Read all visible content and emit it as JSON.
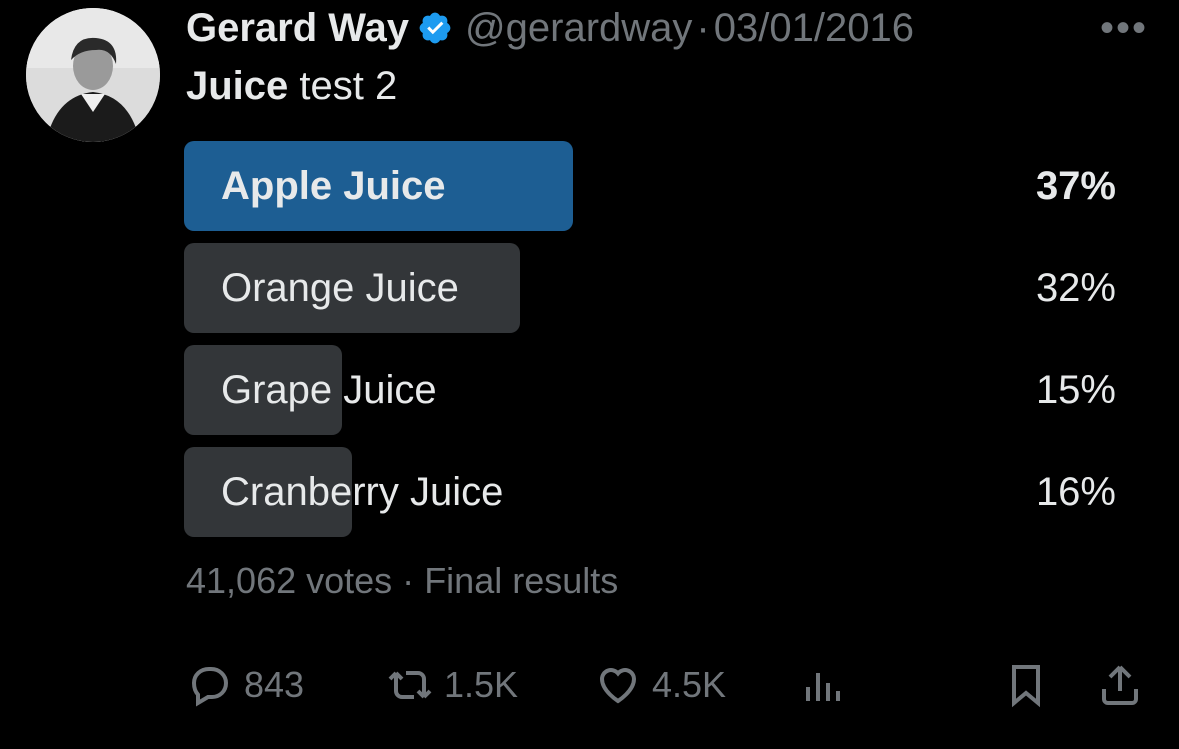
{
  "author": {
    "name": "Gerard Way",
    "handle": "@gerardway",
    "separator": "·",
    "date": "03/01/2016",
    "verified_color": "#1d9bf0"
  },
  "tweet": {
    "text_bold": "Juice",
    "text_rest": " test 2"
  },
  "poll": {
    "options": [
      {
        "label": "Apple Juice",
        "percent_text": "37%",
        "percent": 37,
        "winner": true
      },
      {
        "label": "Orange Juice",
        "percent_text": "32%",
        "percent": 32,
        "winner": false
      },
      {
        "label": "Grape Juice",
        "percent_text": "15%",
        "percent": 15,
        "winner": false
      },
      {
        "label": "Cranberry Juice",
        "percent_text": "16%",
        "percent": 16,
        "winner": false
      }
    ],
    "votes": "41,062 votes",
    "separator": "·",
    "status": "Final results",
    "winner_color": "#1d5e93",
    "bar_color": "#333639"
  },
  "actions": {
    "replies": "843",
    "reposts": "1.5K",
    "likes": "4.5K"
  },
  "icons": [
    "reply-icon",
    "repost-icon",
    "like-icon",
    "views-icon",
    "bookmark-icon",
    "share-icon",
    "more-icon",
    "verified-badge-icon"
  ]
}
